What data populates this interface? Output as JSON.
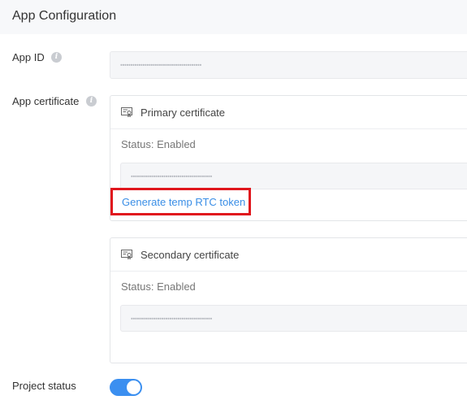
{
  "header": {
    "title": "App Configuration"
  },
  "app_id": {
    "label": "App ID",
    "value": "••••••••••••••••••••••••••••••••••••••••"
  },
  "app_certificate": {
    "label": "App certificate",
    "primary": {
      "title": "Primary certificate",
      "status": "Status: Enabled",
      "value": "••••••••••••••••••••••••••••••••••••••••",
      "action": "Generate temp RTC token"
    },
    "secondary": {
      "title": "Secondary certificate",
      "status": "Status: Enabled",
      "value": "••••••••••••••••••••••••••••••••••••••••"
    }
  },
  "project_status": {
    "label": "Project status",
    "enabled": true
  },
  "colors": {
    "accent": "#3b8ff0",
    "link": "#3a8ee6",
    "highlight_border": "#e0161d"
  },
  "icons": [
    "info-icon",
    "certificate-icon"
  ]
}
